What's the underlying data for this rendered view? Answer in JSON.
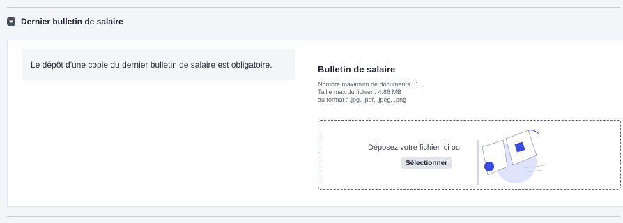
{
  "section": {
    "title": "Dernier bulletin de salaire",
    "toggle_icon": "caret-down-icon"
  },
  "notice": {
    "text": "Le dépôt d'une copie du dernier bulletin de salaire est obligatoire."
  },
  "upload": {
    "title": "Bulletin de salaire",
    "max_documents": "Nombre maximum de documents : 1",
    "max_size": "Taille max du fichier : 4.88 MB",
    "formats": "au format : .jpg, .pdf, .jpeg, .png",
    "drop_text": "Déposez votre fichier ici ou",
    "select_label": "Sélectionner",
    "illustration_icon": "file-upload-illustration"
  },
  "colors": {
    "accent": "#3a4be0",
    "illustration_bg": "#dfe3fb"
  }
}
